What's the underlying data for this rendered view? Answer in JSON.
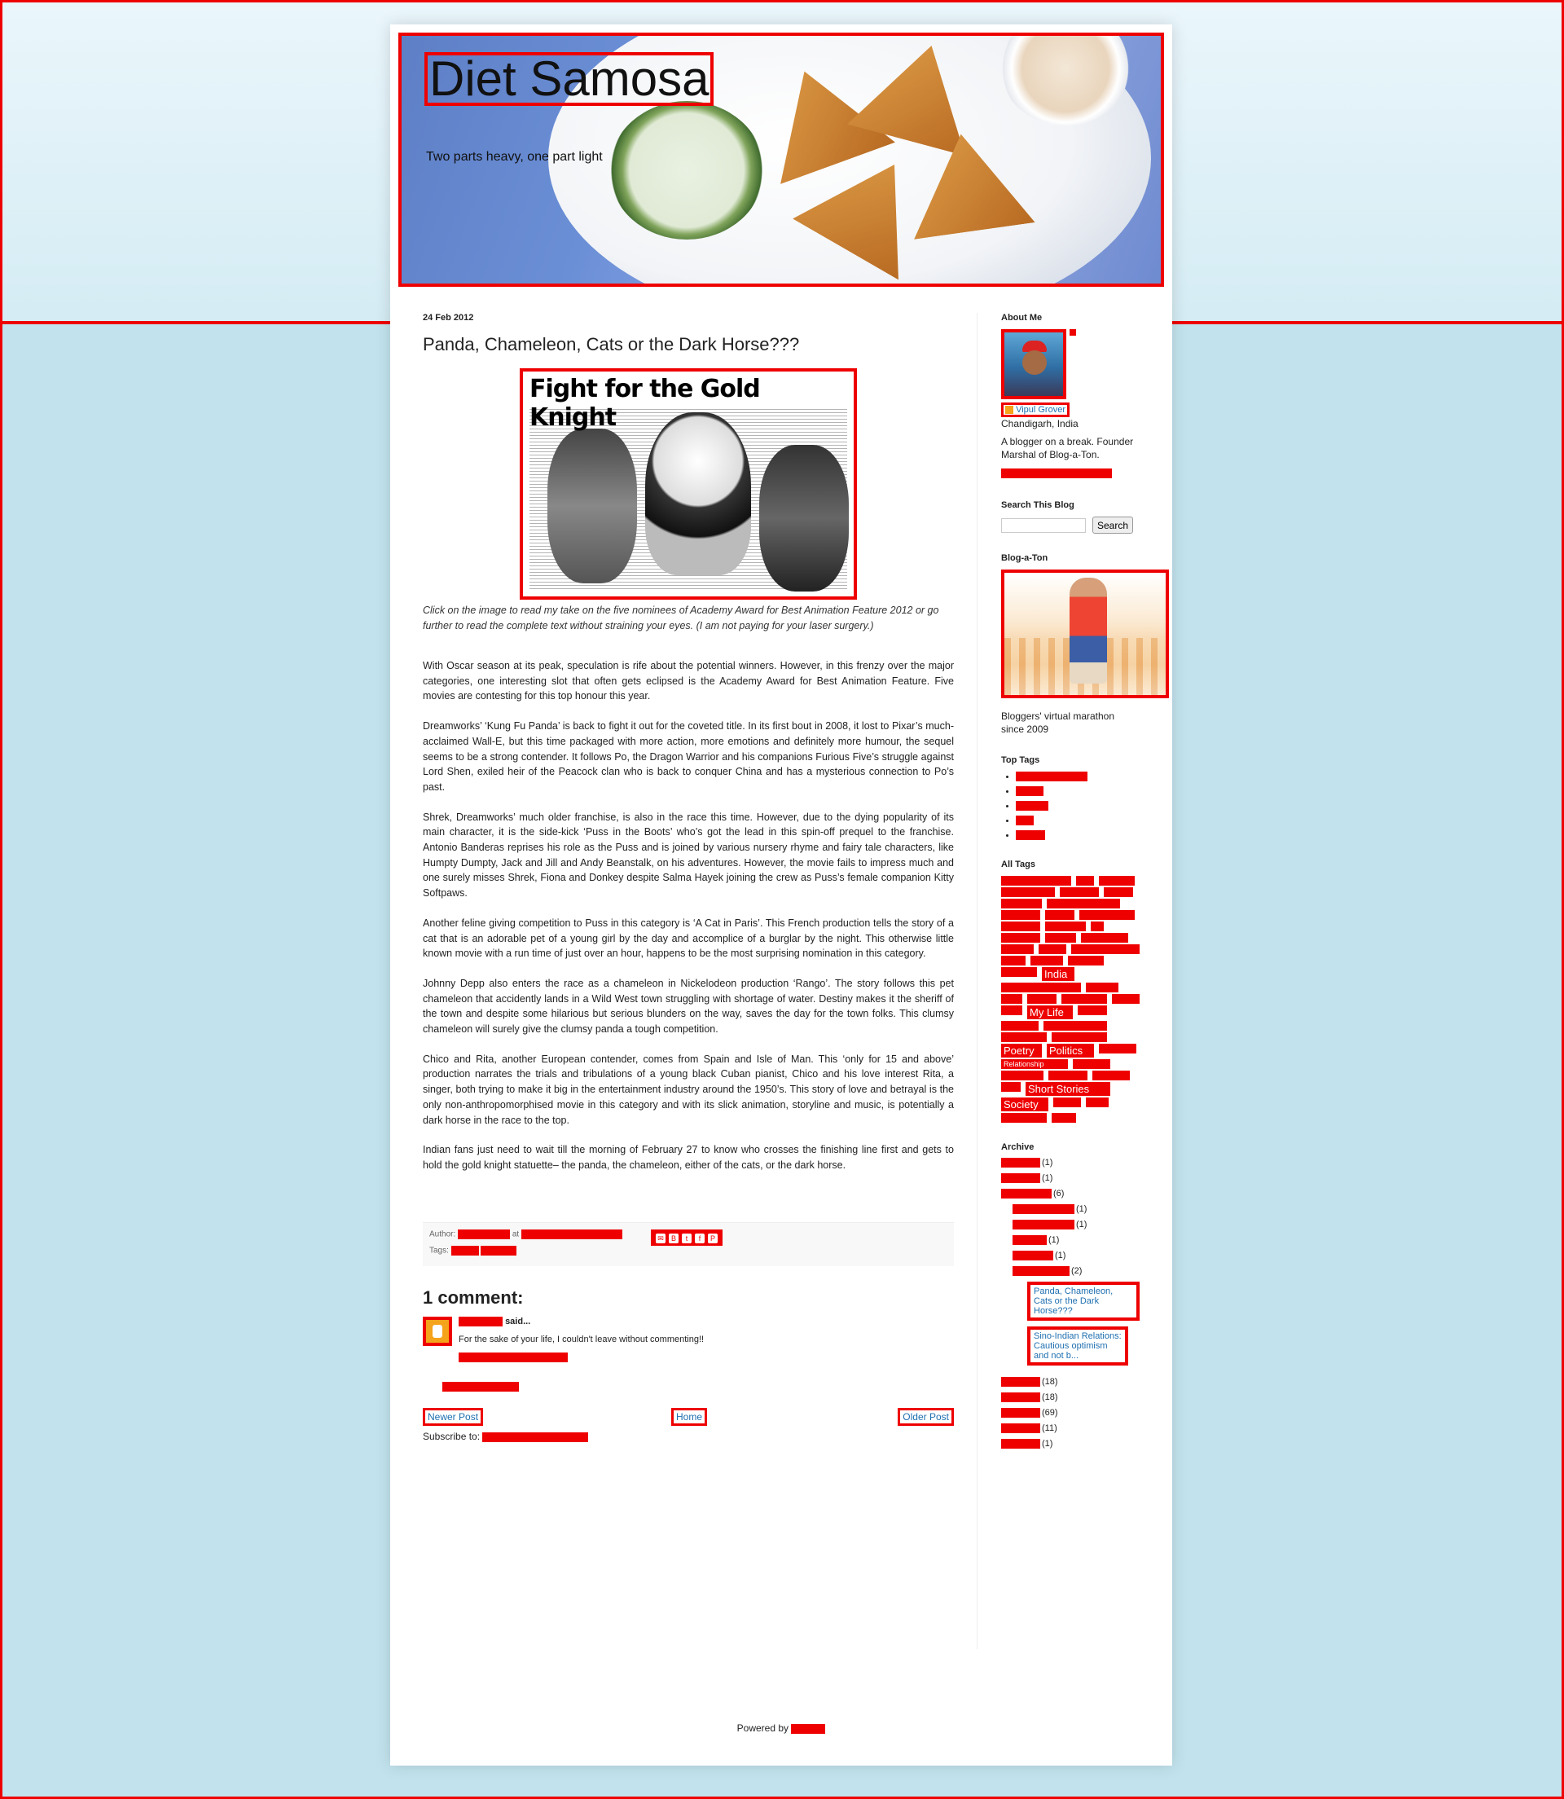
{
  "blog": {
    "title": "Diet Samosa",
    "description": "Two parts heavy, one part light"
  },
  "post": {
    "date": "24 Feb 2012",
    "title": "Panda, Chameleon, Cats or the Dark Horse???",
    "image_headline": "Fight for the Gold Knight",
    "caption": "Click on the image to read my take on the five nominees of  Academy Award for Best Animation Feature 2012 or go further to read the complete text without straining your eyes. (I am not paying for your laser surgery.)",
    "paragraphs": [
      "With Oscar season at its peak, speculation is rife about the potential winners. However, in this frenzy over the major categories, one interesting slot that often gets eclipsed is the Academy Award for Best Animation Feature. Five movies are contesting for this top honour this year.",
      "Dreamworks’ ‘Kung Fu Panda’ is back to fight it out for the coveted title. In its first bout in 2008, it lost to Pixar’s much-acclaimed Wall-E, but this time packaged with more action, more emotions and definitely more humour, the sequel seems to be a strong contender. It follows Po, the Dragon Warrior and his companions Furious Five’s struggle against Lord Shen, exiled heir of the Peacock clan who is back to conquer China and has a mysterious connection to Po’s past.",
      "Shrek, Dreamworks’ much older franchise, is also in the race this time. However, due to the dying popularity of its main character, it is the side-kick ‘Puss in the Boots’ who’s got the lead in this spin-off prequel to the franchise. Antonio Banderas reprises his role as the Puss and is joined by various nursery rhyme and fairy tale characters, like Humpty Dumpty, Jack and Jill and Andy Beanstalk, on his adventures. However, the movie fails to impress much and one surely misses Shrek, Fiona and Donkey despite Salma Hayek joining the crew as Puss’s female companion Kitty Softpaws.",
      "Another feline giving competition to Puss in this category is ‘A Cat in Paris’. This French production tells the story of a cat that is an adorable pet of a young girl by the day and accomplice of a burglar by the night. This otherwise little known movie with a run time of just over an hour, happens to be the most surprising nomination in this category.",
      "Johnny Depp also enters the race as a chameleon in Nickelodeon production ‘Rango’. The story follows this pet chameleon that accidently lands in a Wild West town struggling with shortage of water. Destiny makes it the sheriff of the town and despite some hilarious but serious blunders on the way, saves the day for the town folks. This clumsy chameleon will surely give the clumsy panda a tough competition.",
      "Chico and Rita, another European contender, comes from Spain and Isle of Man. This ‘only for 15 and above’ production narrates the trials and tribulations of a young black Cuban pianist, Chico and his love interest Rita, a singer, both trying to make it big in the entertainment industry around the 1950’s. This story of love and betrayal is the only non-anthropomorphised movie in this category and with its slick animation, storyline and music, is potentially a dark horse in the race to the top.",
      "Indian fans just need to wait till the morning of February 27 to know who crosses the finishing line first and gets to hold the gold knight statuette– the panda, the chameleon, either of the cats, or the dark horse."
    ],
    "footer": {
      "author_label": "Author:",
      "at_label": "at",
      "tags_label": "Tags:"
    }
  },
  "comments": {
    "heading": "1 comment:",
    "said": "said...",
    "body": "For the sake of your life, I couldn't leave without commenting!!"
  },
  "nav": {
    "newer": "Newer Post",
    "home": "Home",
    "older": "Older Post",
    "subscribe": "Subscribe to:"
  },
  "sidebar": {
    "about": {
      "title": "About Me",
      "name": "Vipul Grover",
      "location": "Chandigarh, India",
      "bio": "A blogger on a break. Founder Marshal of Blog-a-Ton."
    },
    "search": {
      "title": "Search This Blog",
      "button": "Search"
    },
    "blogaton": {
      "title": "Blog-a-Ton",
      "text": "Bloggers' virtual marathon since 2009"
    },
    "top_tags": {
      "title": "Top Tags"
    },
    "all_tags": {
      "title": "All Tags",
      "visible": [
        "India",
        "My Life",
        "Politics",
        "Poetry",
        "Relationship",
        "Short Stories",
        "Society"
      ]
    },
    "archive": {
      "title": "Archive",
      "counts": [
        "(1)",
        "(1)",
        "(6)",
        "(1)",
        "(1)",
        "(1)",
        "(1)",
        "(2)",
        "(18)",
        "(18)",
        "(69)",
        "(11)",
        "(1)"
      ],
      "posts": [
        "Panda, Chameleon, Cats or the Dark Horse???",
        "Sino-Indian Relations: Cautious optimism and not b..."
      ]
    }
  },
  "footer": {
    "powered": "Powered by"
  }
}
